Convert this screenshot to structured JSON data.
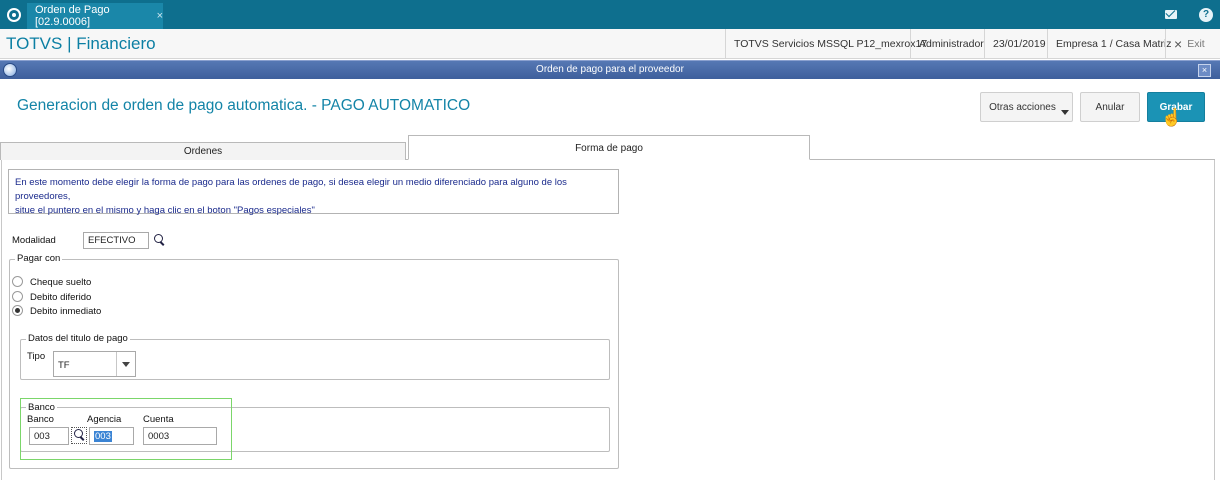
{
  "topbar": {
    "tab_label": "Orden de Pago [02.9.0006]",
    "tab_close": "×"
  },
  "header": {
    "app_title": "TOTVS | Financiero",
    "server": "TOTVS Servicios MSSQL P12_mexrox17",
    "user": "Administrador",
    "date": "23/01/2019",
    "company": "Empresa 1 / Casa Matriz",
    "exit_label": "Exit",
    "exit_icon": "×"
  },
  "dialog": {
    "title": "Orden de pago para el proveedor",
    "close": "×"
  },
  "page": {
    "heading": "Generacion de orden de pago automatica. - PAGO AUTOMATICO"
  },
  "actions": {
    "other": "Otras acciones",
    "cancel": "Anular",
    "save": "Grabar"
  },
  "tabs": [
    {
      "label": "Ordenes"
    },
    {
      "label": "Forma de pago"
    }
  ],
  "info": {
    "line1": "En este momento debe elegir la forma de pago para las ordenes de pago, si desea elegir un medio diferenciado para alguno de los proveedores,",
    "line2": "situe el puntero en el mismo y haga clic en el boton \"Pagos especiales\""
  },
  "modalidad": {
    "label": "Modalidad",
    "value": "EFECTIVO"
  },
  "pagar_con": {
    "legend": "Pagar con",
    "options": [
      {
        "label": "Cheque suelto",
        "selected": false
      },
      {
        "label": "Debito diferido",
        "selected": false
      },
      {
        "label": "Debito inmediato",
        "selected": true
      }
    ]
  },
  "datos_titulo": {
    "legend": "Datos del titulo de pago",
    "tipo_label": "Tipo",
    "tipo_value": "TF"
  },
  "banco": {
    "legend": "Banco",
    "banco_label": "Banco",
    "banco_value": "003",
    "agencia_label": "Agencia",
    "agencia_value": "003",
    "cuenta_label": "Cuenta",
    "cuenta_value": "0003"
  },
  "colors": {
    "topbar": "#0e6f8e",
    "accent": "#1384a7",
    "save_button": "#1b93b5",
    "highlight": "#7bd66a"
  }
}
